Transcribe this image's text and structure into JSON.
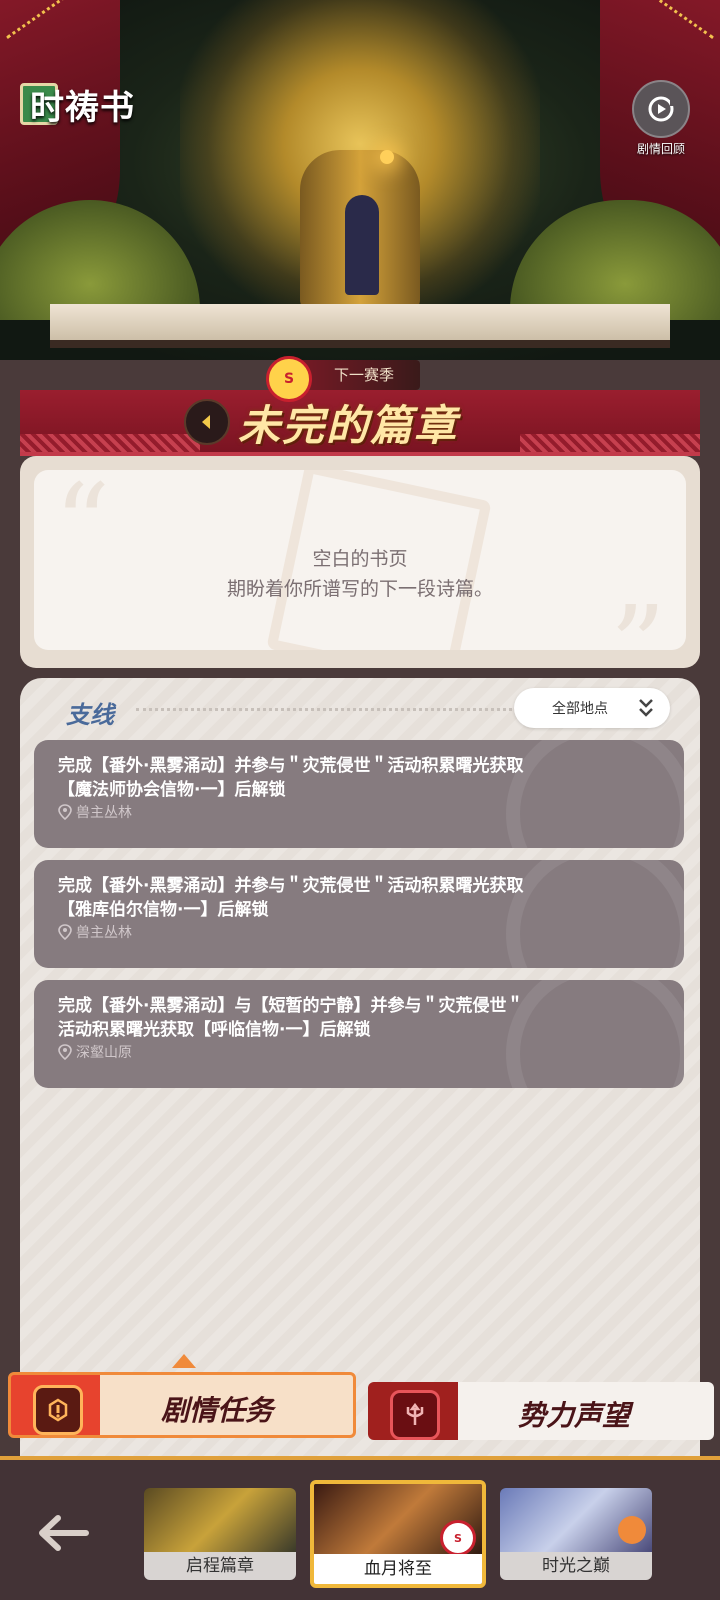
{
  "app": {
    "logo_text": "时祷书"
  },
  "header": {
    "recap_label": "剧情回顾"
  },
  "season": {
    "tag": "下一赛季",
    "badge": "S",
    "chapter_title": "未完的篇章"
  },
  "blank_page": {
    "title": "空白的书页",
    "subtitle": "期盼着你所谱写的下一段诗篇。"
  },
  "side_quests": {
    "title": "支线",
    "filter_label": "全部地点",
    "items": [
      {
        "text": "完成【番外·黑雾涌动】并参与＂灾荒侵世＂活动积累曙光获取【魔法师协会信物·一】后解锁",
        "location": "兽主丛林"
      },
      {
        "text": "完成【番外·黑雾涌动】并参与＂灾荒侵世＂活动积累曙光获取【雅库伯尔信物·一】后解锁",
        "location": "兽主丛林"
      },
      {
        "text": "完成【番外·黑雾涌动】与【短暂的宁静】并参与＂灾荒侵世＂活动积累曙光获取【呼临信物·一】后解锁",
        "location": "深壑山原"
      }
    ]
  },
  "tabs": {
    "story": "剧情任务",
    "reputation": "势力声望"
  },
  "chapters": [
    {
      "name": "启程篇章"
    },
    {
      "name": "血月将至",
      "badge": "S"
    },
    {
      "name": "时光之巅"
    }
  ],
  "colors": {
    "banner": "#9a1e2e",
    "quest_card": "#867b7f",
    "accent": "#f0b83a",
    "title_blue": "#4a6a9a"
  }
}
